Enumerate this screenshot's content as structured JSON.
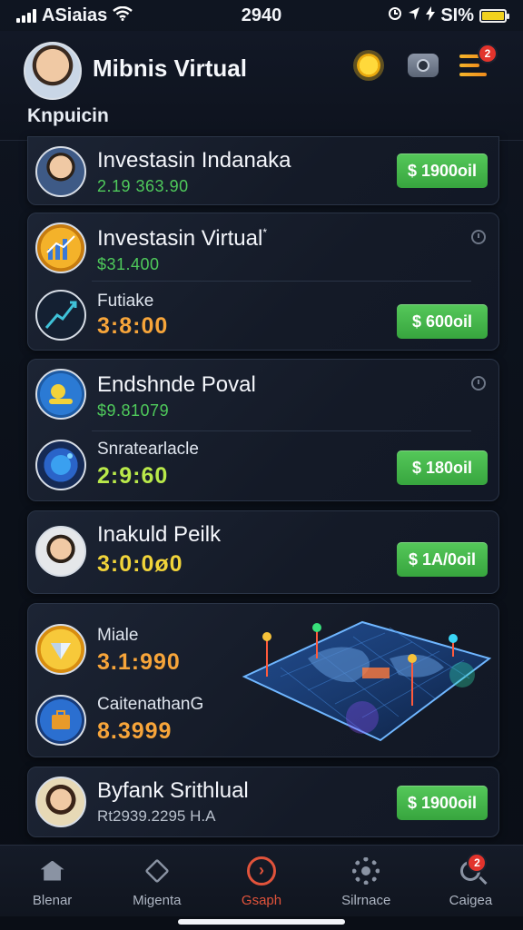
{
  "status_bar": {
    "carrier": "ASiaias",
    "time": "2940",
    "battery_text": "SI%"
  },
  "header": {
    "app_title": "Mibnis Virtual",
    "subtitle": "Knpuicin",
    "icons": [
      "avatar",
      "sun-icon",
      "camera-icon",
      "menu-icon"
    ],
    "menu_badge": "2"
  },
  "cards": [
    {
      "title": "Investasin Indanaka",
      "amount": "2.19 363.90",
      "button": "$ 1900oil"
    },
    {
      "title": "Investasin Virtual",
      "title_mark": "*",
      "amount": "$31.400",
      "row2_label": "Futiake",
      "row2_value": "3:8:00",
      "button": "$ 600oil"
    },
    {
      "title": "Endshnde Poval",
      "amount": "$9.81079",
      "row2_label": "Snratearlacle",
      "row2_value": "2:9:60",
      "button": "$ 180oil"
    },
    {
      "title": "Inakuld Peilk",
      "value": "3:0:0ø0",
      "button": "$ 1A/0oil"
    },
    {
      "row1_label": "Miale",
      "row1_value": "3.1:990",
      "row2_label": "CaitenathanG",
      "row2_value": "8.3999"
    },
    {
      "title": "Byfank Srithlual",
      "amount": "Rt2939.2295 H.A",
      "button": "$ 1900oil"
    }
  ],
  "nav": {
    "items": [
      {
        "label": "Blenar",
        "icon": "home-icon"
      },
      {
        "label": "Migenta",
        "icon": "box-icon"
      },
      {
        "label": "Gsaph",
        "icon": "play-circle-icon",
        "active": true
      },
      {
        "label": "Silrnace",
        "icon": "gear-icon"
      },
      {
        "label": "Caigea",
        "icon": "search-icon",
        "badge": "2"
      }
    ]
  },
  "colors": {
    "accent_green": "#4fca5b",
    "accent_orange": "#f7a53a",
    "active_nav": "#e1533b",
    "background": "#0b1019"
  }
}
